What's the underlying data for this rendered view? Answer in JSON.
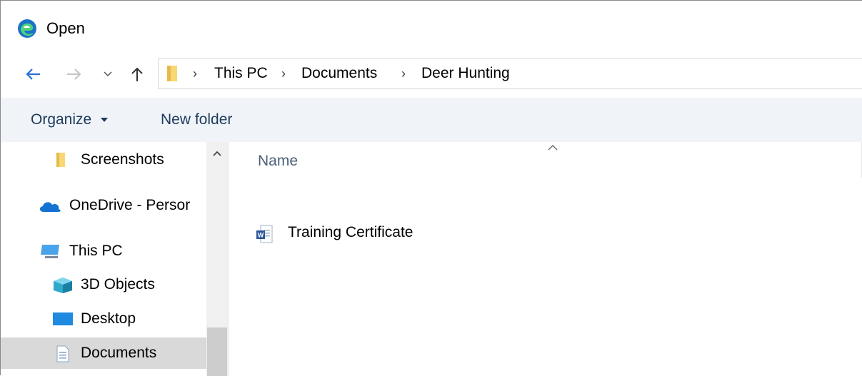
{
  "window": {
    "title": "Open"
  },
  "nav": {
    "back_icon": "back-arrow-icon",
    "forward_icon": "forward-arrow-icon",
    "recent_icon": "chevron-down-icon",
    "up_icon": "up-arrow-icon"
  },
  "breadcrumb": {
    "items": [
      "This PC",
      "Documents",
      "Deer Hunting"
    ],
    "separator": "›"
  },
  "toolbar": {
    "organize_label": "Organize",
    "new_folder_label": "New folder"
  },
  "sidebar": {
    "items": [
      {
        "label": "Screenshots",
        "icon": "folder-icon"
      },
      {
        "label": "OneDrive - Persor",
        "icon": "cloud-icon"
      },
      {
        "label": "This PC",
        "icon": "computer-icon"
      },
      {
        "label": "3D Objects",
        "icon": "cube-icon"
      },
      {
        "label": "Desktop",
        "icon": "desktop-icon"
      },
      {
        "label": "Documents",
        "icon": "document-icon",
        "selected": true
      }
    ]
  },
  "content": {
    "column_name": "Name",
    "files": [
      {
        "name": "Training Certificate",
        "icon": "word-document-icon"
      }
    ]
  },
  "colors": {
    "accent": "#0078d4",
    "toolbar_bg": "#f0f4f9",
    "toolbar_text": "#1e3a5c",
    "selected_bg": "#d9d9d9"
  }
}
